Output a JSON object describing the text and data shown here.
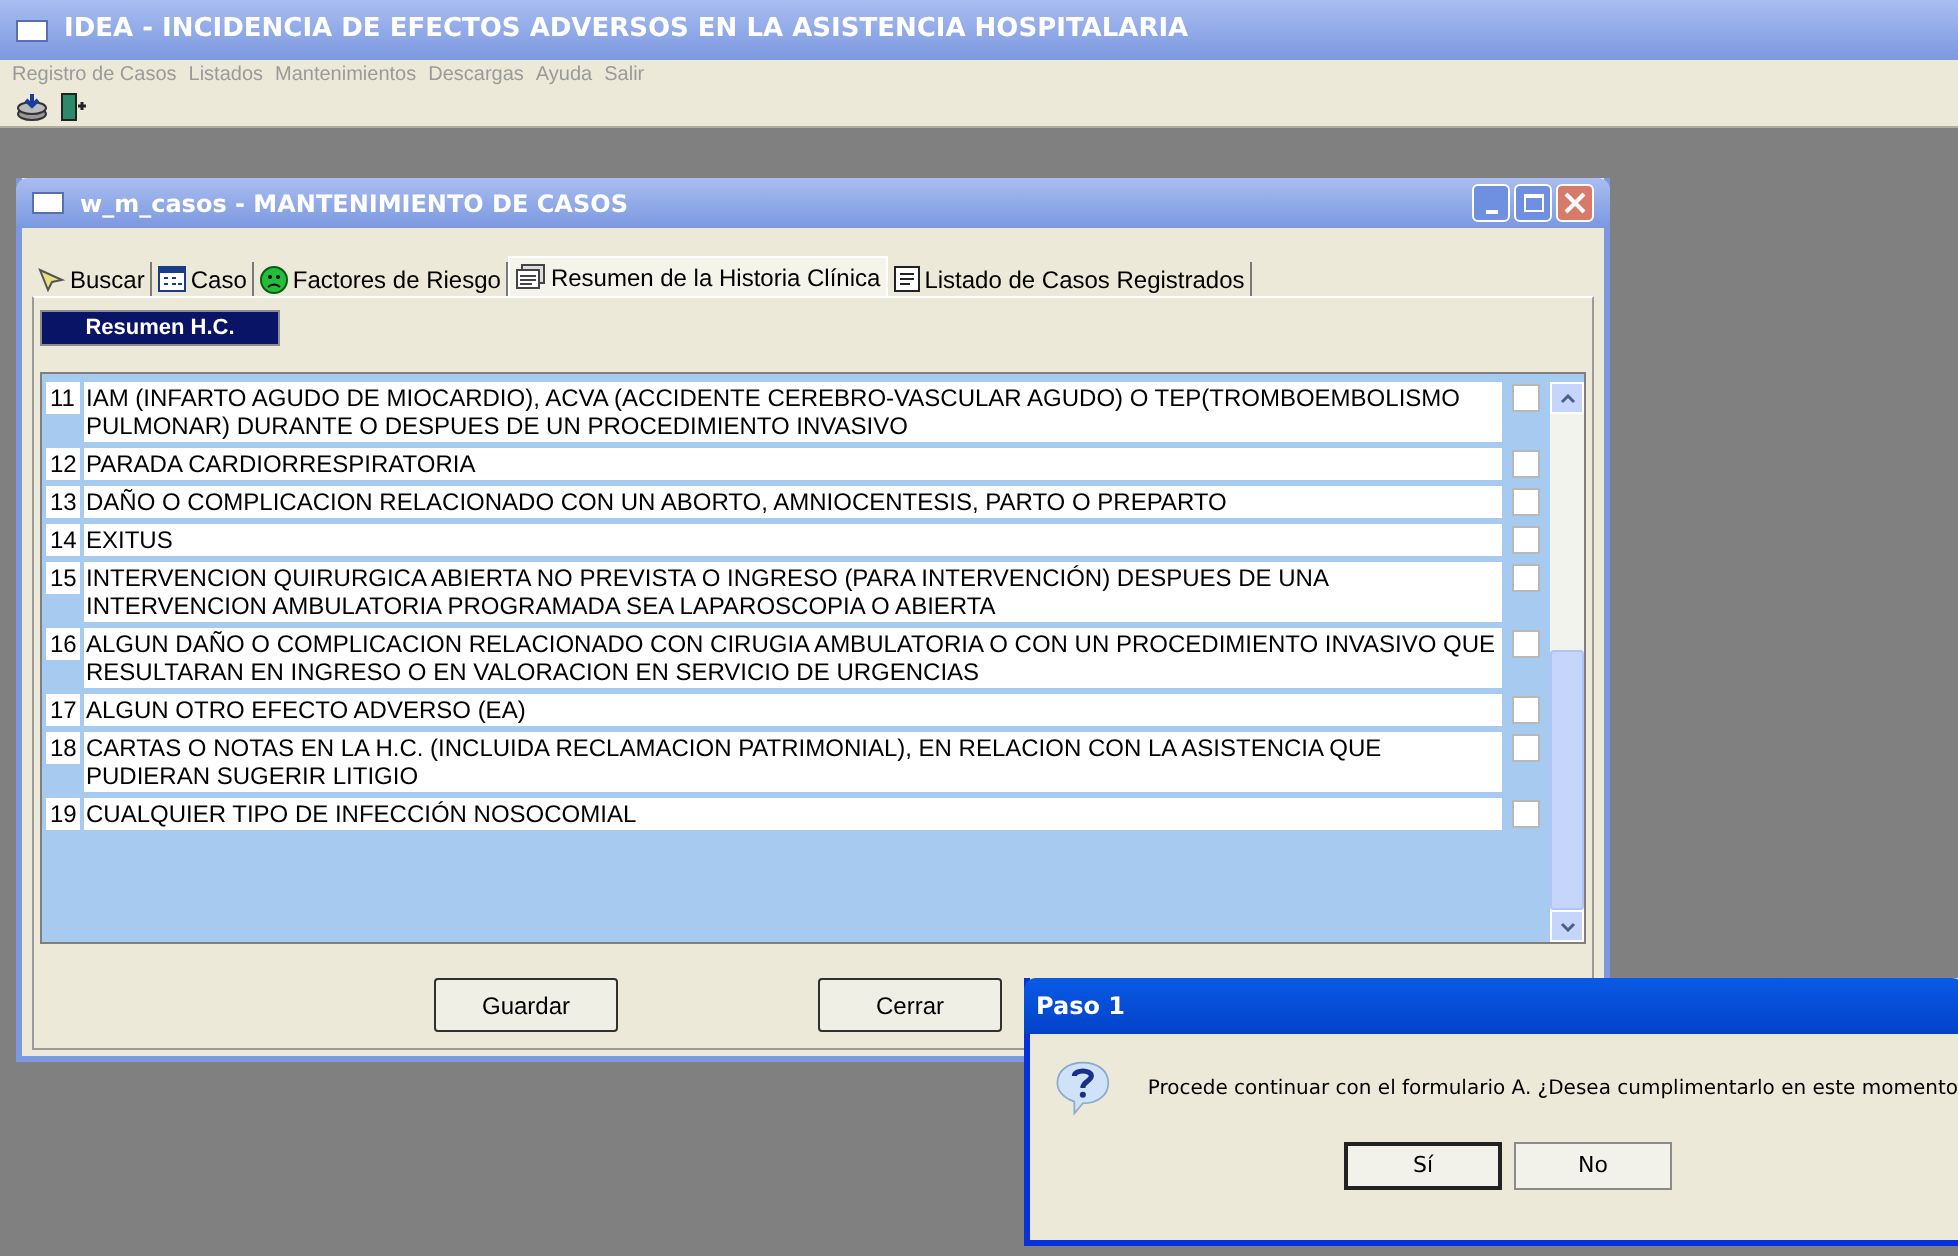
{
  "app": {
    "title": "IDEA - INCIDENCIA DE EFECTOS ADVERSOS EN LA ASISTENCIA HOSPITALARIA"
  },
  "menu": [
    "Registro de Casos",
    "Listados",
    "Mantenimientos",
    "Descargas",
    "Ayuda",
    "Salir"
  ],
  "window": {
    "title": "w_m_casos - MANTENIMIENTO DE CASOS"
  },
  "tabs": [
    {
      "label": "Buscar",
      "kind": "search",
      "selected": false
    },
    {
      "label": "Caso",
      "kind": "case",
      "selected": false
    },
    {
      "label": "Factores de Riesgo",
      "kind": "face",
      "selected": false
    },
    {
      "label": "Resumen de la Historia Clínica",
      "kind": "summary",
      "selected": true
    },
    {
      "label": "Listado de Casos Registrados",
      "kind": "list",
      "selected": false
    }
  ],
  "section_button": "Resumen H.C.",
  "items": [
    {
      "number": "11",
      "text": "IAM (INFARTO AGUDO DE MIOCARDIO), ACVA (ACCIDENTE CEREBRO-VASCULAR AGUDO) O TEP(TROMBOEMBOLISMO PULMONAR) DURANTE O DESPUES DE UN PROCEDIMIENTO INVASIVO",
      "checked": false
    },
    {
      "number": "12",
      "text": "PARADA CARDIORRESPIRATORIA",
      "checked": false
    },
    {
      "number": "13",
      "text": "DAÑO O COMPLICACION RELACIONADO CON UN ABORTO, AMNIOCENTESIS, PARTO O PREPARTO",
      "checked": false
    },
    {
      "number": "14",
      "text": "EXITUS",
      "checked": false
    },
    {
      "number": "15",
      "text": "INTERVENCION QUIRURGICA ABIERTA NO PREVISTA O INGRESO (PARA INTERVENCIÓN) DESPUES DE UNA INTERVENCION AMBULATORIA PROGRAMADA SEA LAPAROSCOPIA O ABIERTA",
      "checked": false
    },
    {
      "number": "16",
      "text": "ALGUN DAÑO O COMPLICACION RELACIONADO CON CIRUGIA AMBULATORIA O CON UN PROCEDIMIENTO INVASIVO QUE RESULTARAN EN INGRESO O EN VALORACION EN SERVICIO DE URGENCIAS",
      "checked": false
    },
    {
      "number": "17",
      "text": "ALGUN OTRO EFECTO ADVERSO (EA)",
      "checked": false
    },
    {
      "number": "18",
      "text": "CARTAS O NOTAS EN LA H.C. (INCLUIDA RECLAMACION PATRIMONIAL), EN RELACION CON LA ASISTENCIA QUE PUDIERAN SUGERIR LITIGIO",
      "checked": false
    },
    {
      "number": "19",
      "text": "CUALQUIER TIPO DE INFECCIÓN NOSOCOMIAL",
      "checked": false
    }
  ],
  "buttons": [
    "Guardar",
    "Cerrar"
  ],
  "dialog": {
    "title": "Paso 1",
    "message": "Procede continuar con el formulario A. ¿Desea cumplimentarlo en este momento",
    "buttons": [
      "Sí",
      "No"
    ]
  }
}
